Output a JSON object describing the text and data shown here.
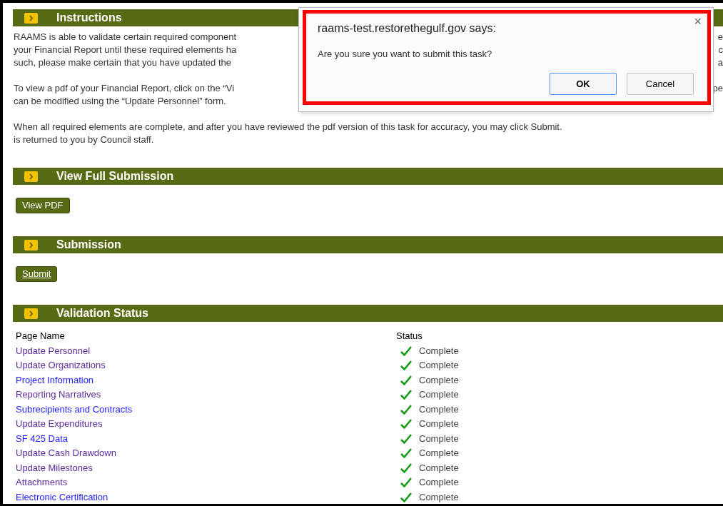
{
  "sections": [
    {
      "title": "Instructions",
      "kind": "text",
      "lines": [
        {
          "left": "RAAMS is able to validate certain required component",
          "right": "e"
        },
        {
          "left": "your Financial Report until these required elements ha",
          "right": "c"
        },
        {
          "left": "such, please make certain that you have updated the",
          "right": "a"
        },
        {
          "kind": "gap"
        },
        {
          "left": "To view a pdf of your Financial Report, click on the “Vi",
          "right": "pe"
        },
        {
          "left": "can be modified using the “Update Personnel” form."
        },
        {
          "kind": "gap"
        },
        {
          "left": "When all required elements are complete, and after you have reviewed the pdf version of this task for accuracy, you may click Submit."
        },
        {
          "left": "is returned to you by Council staff."
        }
      ]
    },
    {
      "title": "View Full Submission",
      "kind": "button",
      "button": {
        "label": "View PDF",
        "underlined": false
      }
    },
    {
      "title": "Submission",
      "kind": "button",
      "button": {
        "label": "Submit",
        "underlined": true
      }
    },
    {
      "title": "Validation Status",
      "kind": "table",
      "columns": [
        "Page Name",
        "Status"
      ],
      "rows": [
        {
          "page": "Update Personnel",
          "visited": true,
          "status": "Complete",
          "complete": true
        },
        {
          "page": "Update Organizations",
          "visited": true,
          "status": "Complete",
          "complete": true
        },
        {
          "page": "Project Information",
          "visited": false,
          "status": "Complete",
          "complete": true
        },
        {
          "page": "Reporting Narratives",
          "visited": true,
          "status": "Complete",
          "complete": true
        },
        {
          "page": "Subrecipients and Contracts",
          "visited": false,
          "status": "Complete",
          "complete": true
        },
        {
          "page": "Update Expenditures",
          "visited": true,
          "status": "Complete",
          "complete": true
        },
        {
          "page": "SF 425 Data",
          "visited": false,
          "status": "Complete",
          "complete": true
        },
        {
          "page": "Update Cash Drawdown",
          "visited": true,
          "status": "Complete",
          "complete": true
        },
        {
          "page": "Update Milestones",
          "visited": true,
          "status": "Complete",
          "complete": true
        },
        {
          "page": "Attachments",
          "visited": true,
          "status": "Complete",
          "complete": true
        },
        {
          "page": "Electronic Certification",
          "visited": false,
          "status": "Complete",
          "complete": true
        }
      ]
    }
  ],
  "dialog": {
    "title": "raams-test.restorethegulf.gov says:",
    "message": "Are you sure you want to submit this task?",
    "close": "×",
    "buttons": [
      {
        "label": "OK",
        "default": true
      },
      {
        "label": "Cancel",
        "default": false
      }
    ],
    "highlighted": true
  }
}
